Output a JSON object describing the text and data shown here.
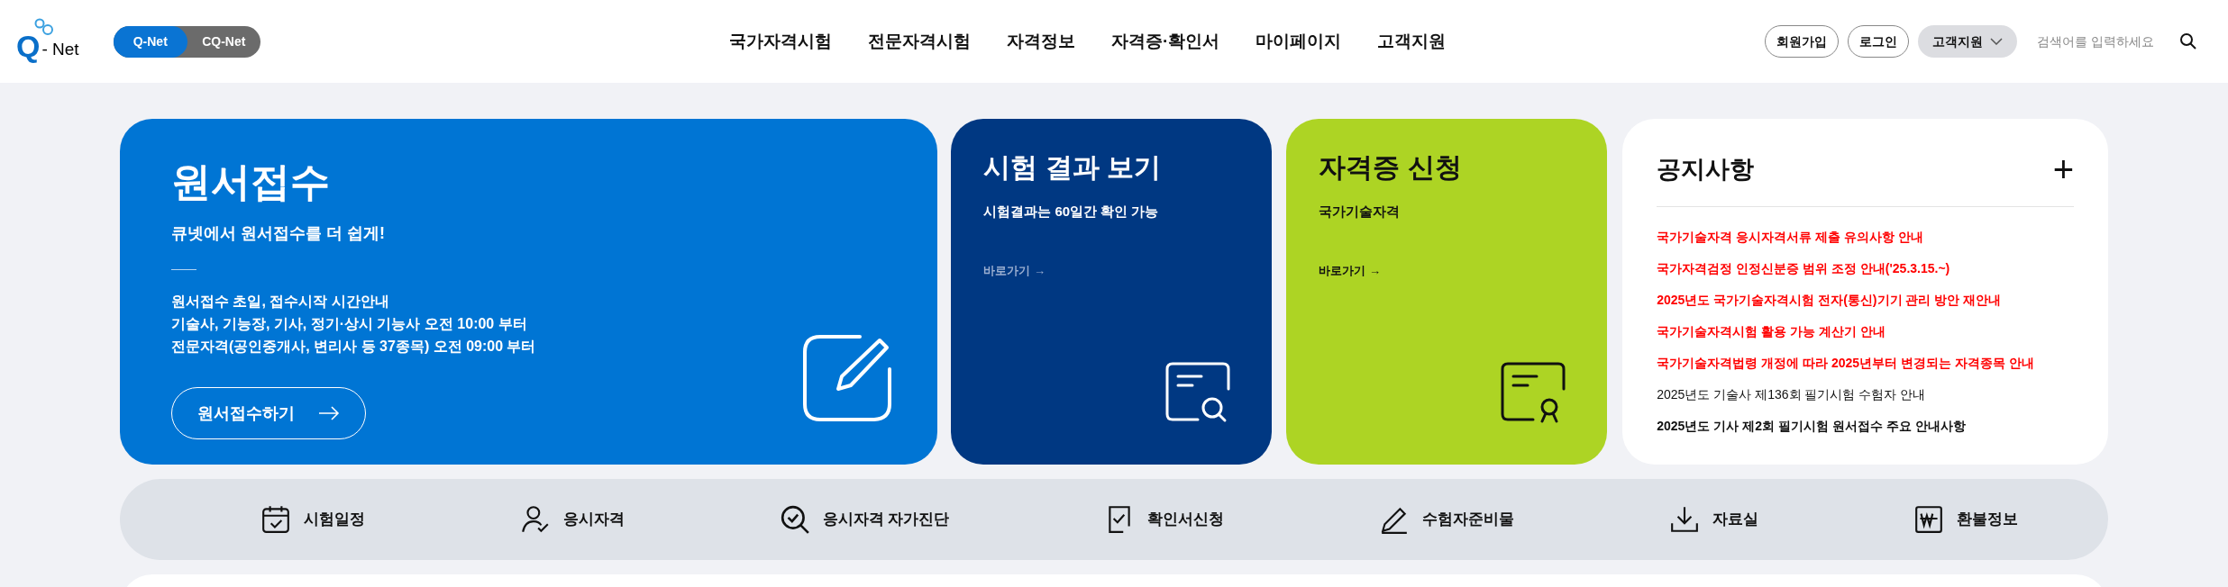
{
  "logo": {
    "mark": "Q",
    "text": "- Net"
  },
  "site_tabs": [
    {
      "label": "Q-Net",
      "selected": true
    },
    {
      "label": "CQ-Net",
      "selected": false
    }
  ],
  "nav": [
    "국가자격시험",
    "전문자격시험",
    "자격정보",
    "자격증·확인서",
    "마이페이지",
    "고객지원"
  ],
  "header_buttons": [
    {
      "label": "회원가입",
      "kind": "outline"
    },
    {
      "label": "로그인",
      "kind": "outline"
    },
    {
      "label": "고객지원",
      "kind": "dropdown"
    }
  ],
  "search": {
    "placeholder": "검색어를 입력하세요"
  },
  "main_card": {
    "title": "원서접수",
    "subtitle": "큐넷에서 원서접수를 더 쉽게!",
    "info": [
      "원서접수 초일, 접수시작 시간안내",
      "기술사, 기능장, 기사, 정기·상시 기능사 오전 10:00 부터",
      "전문자격(공인중개사, 변리사 등 37종목) 오전 09:00 부터"
    ],
    "button": "원서접수하기"
  },
  "cards": [
    {
      "title": "시험 결과 보기",
      "subtitle": "시험결과는 60일간 확인 가능",
      "link": "바로가기 →",
      "kind": "result"
    },
    {
      "title": "자격증 신청",
      "subtitle": "국가기술자격",
      "link": "바로가기 →",
      "kind": "certificate"
    }
  ],
  "notices": {
    "title": "공지사항",
    "more": "+",
    "items": [
      {
        "text": "국가기술자격 응시자격서류 제출 유의사항 안내",
        "color": "#ff0000",
        "bold": true
      },
      {
        "text": "국가자격검정 인정신분증 범위 조정 안내('25.3.15.~)",
        "color": "#ff0000",
        "bold": true
      },
      {
        "text": "2025년도 국가기술자격시험 전자(통신)기기 관리 방안 재안내",
        "color": "#ff0000",
        "bold": true
      },
      {
        "text": "국가기술자격시험 활용 가능 계산기 안내",
        "color": "#ff0000",
        "bold": true
      },
      {
        "text": "국가기술자격법령 개정에 따라 2025년부터 변경되는 자격종목 안내",
        "color": "#ff0000",
        "bold": true
      },
      {
        "text": "2025년도 기술사 제136회 필기시험 수험자 안내",
        "color": "#111111",
        "bold": false
      },
      {
        "text": "2025년도 기사 제2회 필기시험 원서접수 주요 안내사항",
        "color": "#111111",
        "bold": true
      }
    ]
  },
  "quick_links": [
    "시험일정",
    "응시자격",
    "응시자격 자가진단",
    "확인서신청",
    "수험자준비물",
    "자료실",
    "환불정보"
  ]
}
